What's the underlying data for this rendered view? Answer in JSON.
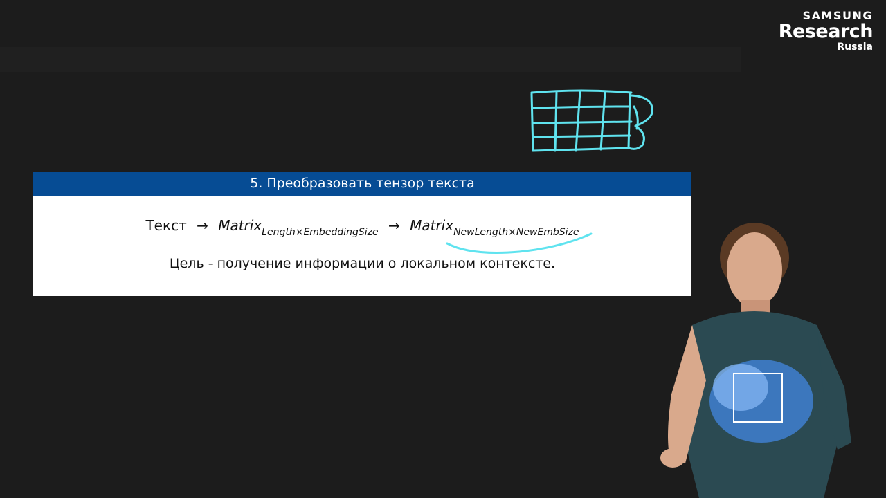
{
  "logo": {
    "line1": "SAMSUNG",
    "line2": "Research",
    "line3": "Russia"
  },
  "block": {
    "number": "5.",
    "title": "Преобразовать тензор текста",
    "formula": {
      "source": "Текст",
      "arrow": "→",
      "matrix": "Matrix",
      "sub1_a": "Length",
      "sub1_b": "EmbeddingSize",
      "sub2_a": "NewLength",
      "sub2_b": "NewEmbSize",
      "times": "×"
    },
    "goal": "Цель - получение информации о локальном контексте."
  },
  "colors": {
    "background": "#1c1c1c",
    "header": "#064c94",
    "annotation": "#5fe3ef"
  }
}
